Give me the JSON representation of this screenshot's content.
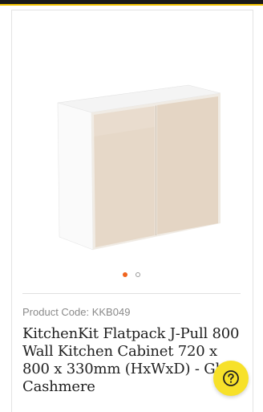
{
  "product": {
    "code_label": "Product Code: KKB049",
    "title": "KitchenKit Flatpack J-Pull 800 Wall Kitchen Cabinet 720 x 800 x 330mm (HxWxD) - Gloss Cashmere",
    "image_icon": "wall-cabinet-image"
  },
  "gallery": {
    "slide_count": 2,
    "active_index": 0
  },
  "colors": {
    "active_dot": "#f0641e",
    "door": "#e6d8c8",
    "help_button": "#f7e12a",
    "header": "#1a1a1a",
    "header_accent": "#f2c200"
  },
  "help": {
    "icon": "question-circle-icon"
  }
}
